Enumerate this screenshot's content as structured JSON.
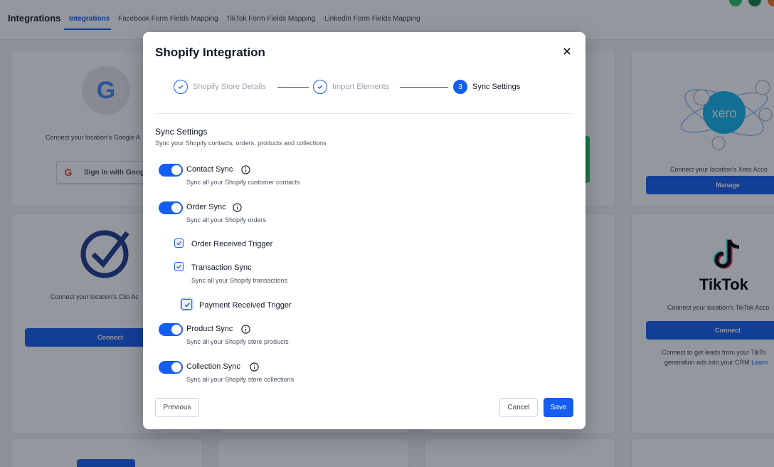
{
  "app": {
    "title": "Integrations",
    "tabs": [
      {
        "label": "Integrations",
        "active": true
      },
      {
        "label": "Facebook Form Fields Mapping",
        "active": false
      },
      {
        "label": "TikTok Form Fields Mapping",
        "active": false
      },
      {
        "label": "LinkedIn Form Fields Mapping",
        "active": false
      }
    ]
  },
  "background_cards": {
    "google": {
      "text": "Connect your location's Google A",
      "button": "Sign in with Goog"
    },
    "clio": {
      "text": "Connect your location's Clio Ac",
      "button": "Connect"
    },
    "xero": {
      "logo_text": "xero",
      "text": "Connect your location's Xero Acco",
      "button": "Manage"
    },
    "tiktok": {
      "logo_text": "TikTok",
      "text": "Connect your location's TikTok Acco",
      "button": "Connect",
      "desc_line1": "Connect to get leads from your TikTo",
      "desc_line2": "generation ads into your CRM",
      "link": "Learn"
    },
    "partial_text": "t"
  },
  "modal": {
    "title": "Shopify Integration",
    "steps": [
      {
        "number": "1",
        "label": "Shopify Store Details",
        "state": "done"
      },
      {
        "number": "2",
        "label": "Import Elements",
        "state": "done"
      },
      {
        "number": "3",
        "label": "Sync Settings",
        "state": "current"
      }
    ],
    "section_title": "Sync Settings",
    "section_desc": "Sync your Shopify contacts, orders, products and collections",
    "options": {
      "contact": {
        "label": "Contact Sync",
        "desc": "Sync all your Shopify customer contacts",
        "enabled": true
      },
      "order": {
        "label": "Order Sync",
        "desc": "Sync all your Shopify orders",
        "enabled": true
      },
      "order_received": {
        "label": "Order Received Trigger",
        "checked": true
      },
      "transaction": {
        "label": "Transaction Sync",
        "desc": "Sync all your Shopify transactions",
        "checked": true
      },
      "payment_received": {
        "label": "Payment Received Trigger",
        "checked": true
      },
      "product": {
        "label": "Product Sync",
        "desc": "Sync all your Shopify store products",
        "enabled": true
      },
      "collection": {
        "label": "Collection Sync",
        "desc": "Sync all your Shopify store collections",
        "enabled": true
      }
    },
    "buttons": {
      "previous": "Previous",
      "cancel": "Cancel",
      "save": "Save"
    }
  },
  "colors": {
    "accent": "#155eef",
    "overlay": "rgba(17,24,39,0.45)"
  }
}
